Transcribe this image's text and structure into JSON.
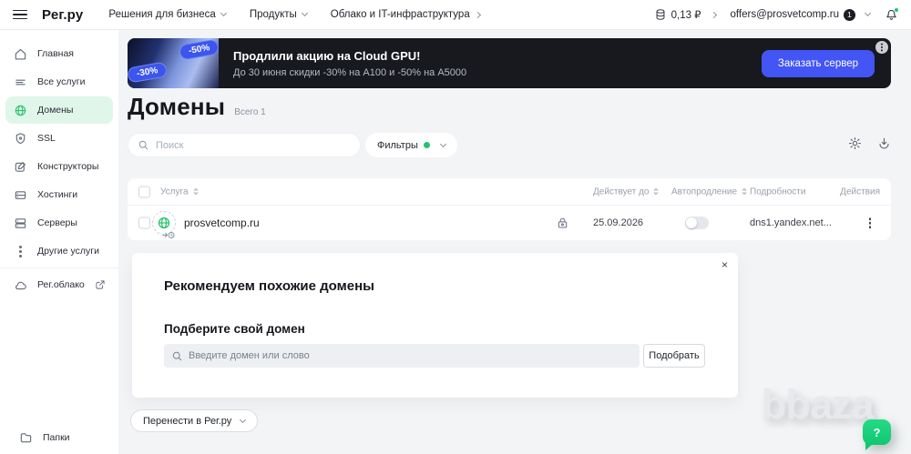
{
  "header": {
    "logo": "Рег.ру",
    "nav": [
      {
        "label": "Решения для бизнеса"
      },
      {
        "label": "Продукты"
      },
      {
        "label": "Облако и IT-инфраструктура"
      }
    ],
    "balance": "0,13 ₽",
    "email": "offers@prosvetcomp.ru",
    "notifications_count": "1"
  },
  "sidebar": {
    "items": [
      {
        "label": "Главная"
      },
      {
        "label": "Все услуги"
      },
      {
        "label": "Домены"
      },
      {
        "label": "SSL"
      },
      {
        "label": "Конструкторы"
      },
      {
        "label": "Хостинги"
      },
      {
        "label": "Серверы"
      },
      {
        "label": "Другие услуги"
      },
      {
        "label": "Рег.облако"
      }
    ],
    "folders_label": "Папки"
  },
  "banner": {
    "badge_top": "-50%",
    "badge_bottom": "-30%",
    "title": "Продлили акцию на Cloud GPU!",
    "subtitle": "До 30 июня скидки -30% на A100 и -50% на A5000",
    "cta": "Заказать сервер"
  },
  "page": {
    "title": "Домены",
    "total": "Всего 1",
    "search_placeholder": "Поиск",
    "filters_label": "Фильтры"
  },
  "table": {
    "columns": [
      "Услуга",
      "Действует до",
      "Автопродление",
      "Подробности",
      "Действия"
    ],
    "rows": [
      {
        "name": "prosvetcomp.ru",
        "expires": "25.09.2026",
        "autorenew_on": false,
        "details": "dns1.yandex.net..."
      }
    ]
  },
  "recommend": {
    "title": "Рекомендуем похожие домены",
    "subtitle": "Подберите свой домен",
    "input_placeholder": "Введите домен или слово",
    "button": "Подобрать",
    "close": "×"
  },
  "footer": {
    "transfer_label": "Перенести в Рег.ру"
  },
  "watermark": "bbaza",
  "chat": {
    "label": "?"
  },
  "colors": {
    "accent_green": "#22c46d",
    "active_item_bg": "#e0f6ea",
    "primary_blue": "#4355f5",
    "badge_blue": "#3c55ee",
    "banner_bg": "#17191f"
  }
}
